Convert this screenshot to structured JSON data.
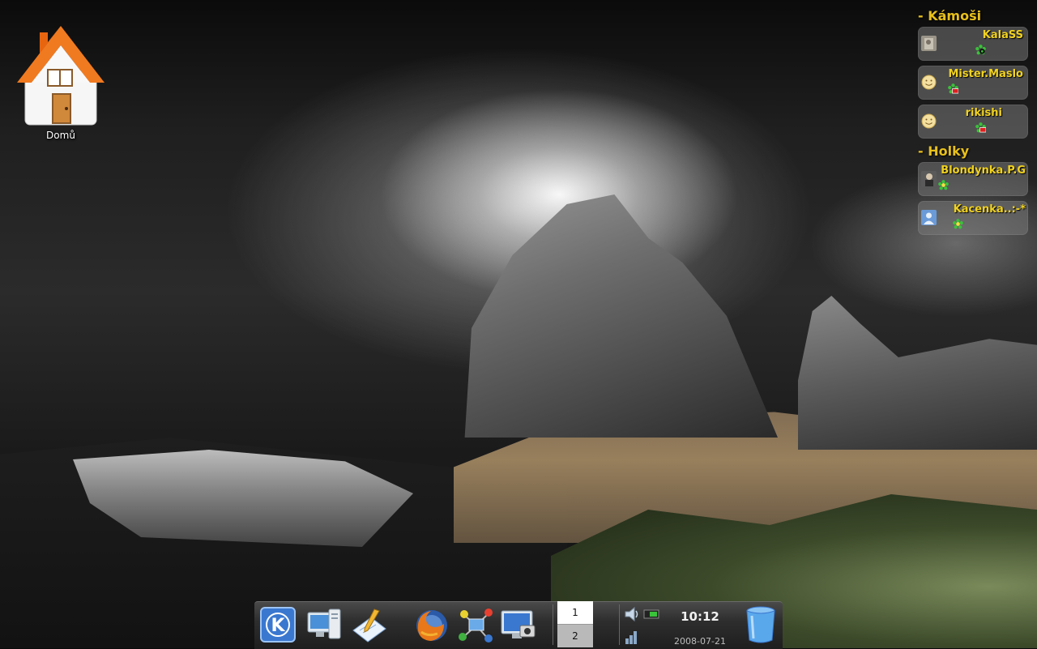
{
  "desktop": {
    "home_icon": {
      "label": "Domů",
      "icon": "home-icon"
    }
  },
  "contact_list": {
    "groups": [
      {
        "title": "- Kámoši",
        "contacts": [
          {
            "name": "KalaSS",
            "status_icon": "icq-online-icon",
            "avatar": "photo-avatar"
          },
          {
            "name": "Mister.Maslo",
            "status_icon": "icq-away-icon",
            "avatar": "smiley-avatar"
          },
          {
            "name": "rikishi",
            "status_icon": "icq-away-icon",
            "avatar": "smiley-avatar"
          }
        ]
      },
      {
        "title": "- Holky",
        "contacts": [
          {
            "name": "Blondynka.P.G",
            "status_icon": "icq-online-icon",
            "avatar": "photo-avatar"
          },
          {
            "name": "Kacenka..:-*",
            "status_icon": "icq-online-icon",
            "avatar": "user-avatar"
          }
        ]
      }
    ]
  },
  "taskbar": {
    "launchers": [
      "kde-menu-icon",
      "system-icon",
      "text-editor-icon",
      "firefox-icon",
      "network-icon",
      "screenshot-icon"
    ],
    "pager": {
      "desktop1": "1",
      "desktop2": "2"
    },
    "clock": {
      "time": "10:12",
      "date": "2008-07-21"
    },
    "trash_icon": "trash-icon"
  },
  "colors": {
    "contact_name": "#f1d21e",
    "group_title": "#e8c01a",
    "taskbar_bg": "#2e2e2e"
  }
}
